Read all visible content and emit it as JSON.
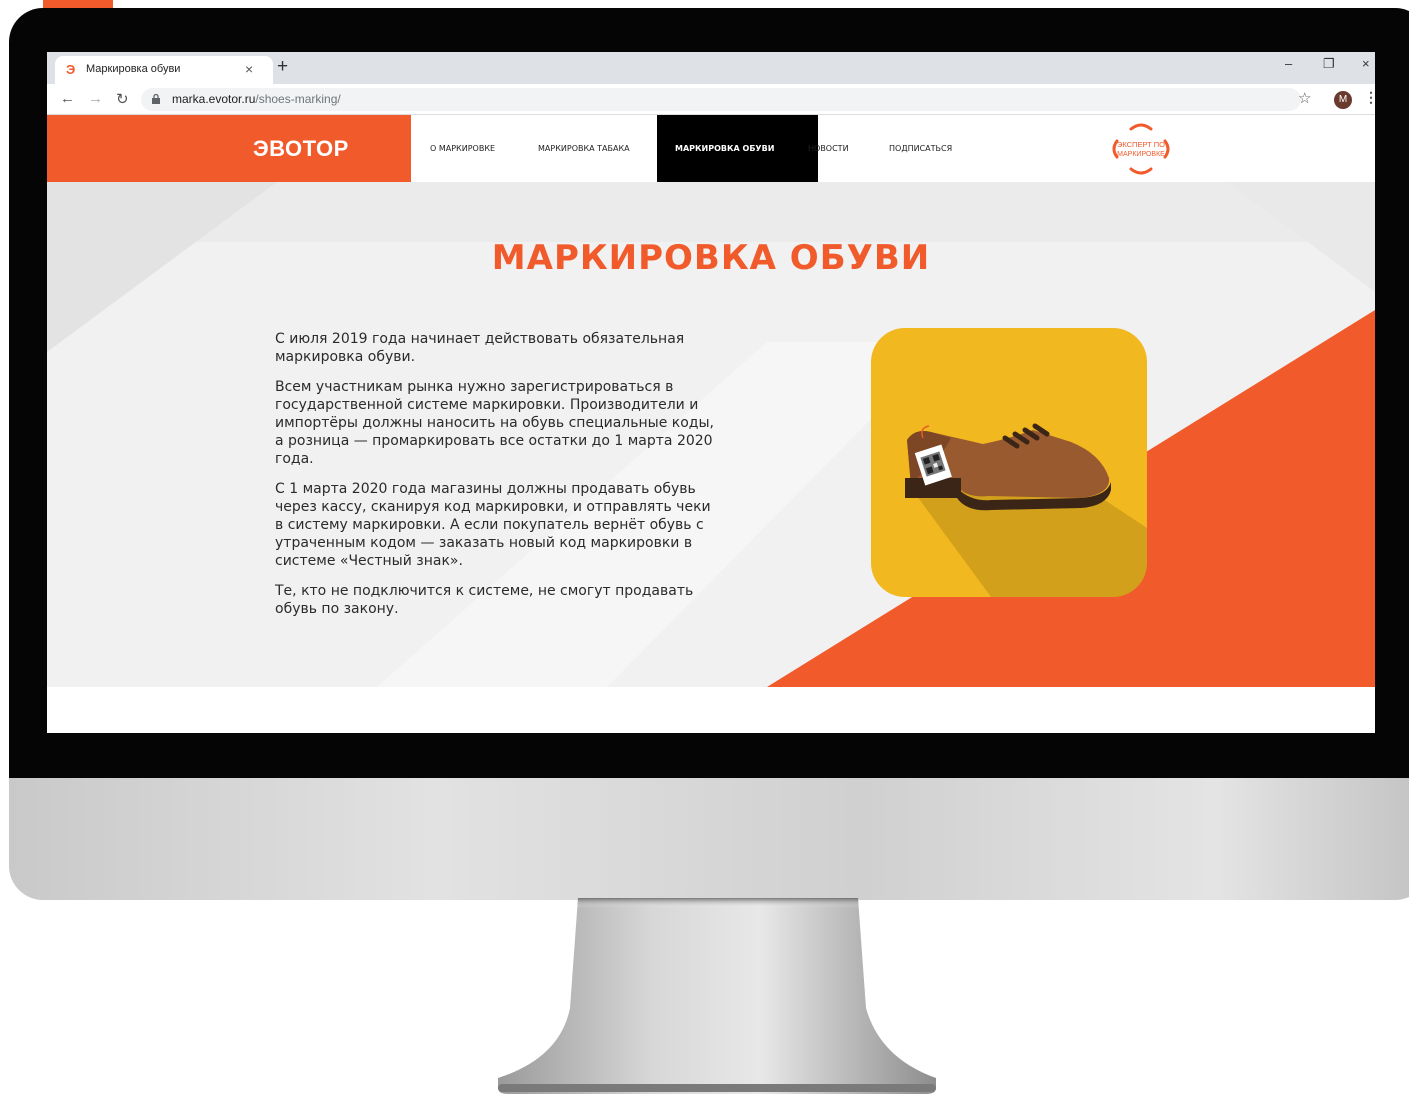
{
  "browser": {
    "tab_title": "Маркировка обуви",
    "tab_close": "×",
    "new_tab": "+",
    "url_host": "marka.evotor.ru",
    "url_path": "/shoes-marking/",
    "avatar_letter": "M",
    "window_controls": {
      "minimize": "–",
      "restore": "❐",
      "close": "×"
    },
    "nav_icons": [
      "back-icon",
      "forward-icon",
      "reload-icon",
      "lock-icon",
      "star-icon",
      "menu-icon"
    ]
  },
  "site": {
    "logo": "ЭВОТОР",
    "nav": [
      {
        "label": "О МАРКИРОВКЕ",
        "active": false
      },
      {
        "label": "МАРКИРОВКА ТАБАКА",
        "active": false
      },
      {
        "label": "МАРКИРОВКА ОБУВИ",
        "active": true
      },
      {
        "label": "НОВОСТИ",
        "active": false
      },
      {
        "label": "ПОДПИСАТЬСЯ",
        "active": false
      }
    ],
    "badge_line1": "ЭКСПЕРТ ПО",
    "badge_line2": "МАРКИРОВКЕ"
  },
  "hero": {
    "title": "МАРКИРОВКА ОБУВИ",
    "paragraphs": [
      "С июля 2019 года начинает действовать обязательная маркировка обуви.",
      "Всем участникам рынка нужно зарегистрироваться в государственной системе маркировки. Производители и импортёры должны наносить на обувь специальные коды, а розница — промаркировать все остатки до 1 марта 2020 года.",
      "С 1 марта 2020 года магазины должны продавать обувь через кассу, сканируя код маркировки, и отправлять чеки в систему маркировки. А если покупатель вернёт обувь с утраченным кодом — заказать новый код маркировки в системе «Честный знак».",
      "Те, кто не подключится к системе, не смогут продавать обувь по закону."
    ]
  },
  "colors": {
    "brand_orange": "#f15a2b",
    "card_yellow": "#f2b81f",
    "shoe_brown": "#9a5a30"
  }
}
